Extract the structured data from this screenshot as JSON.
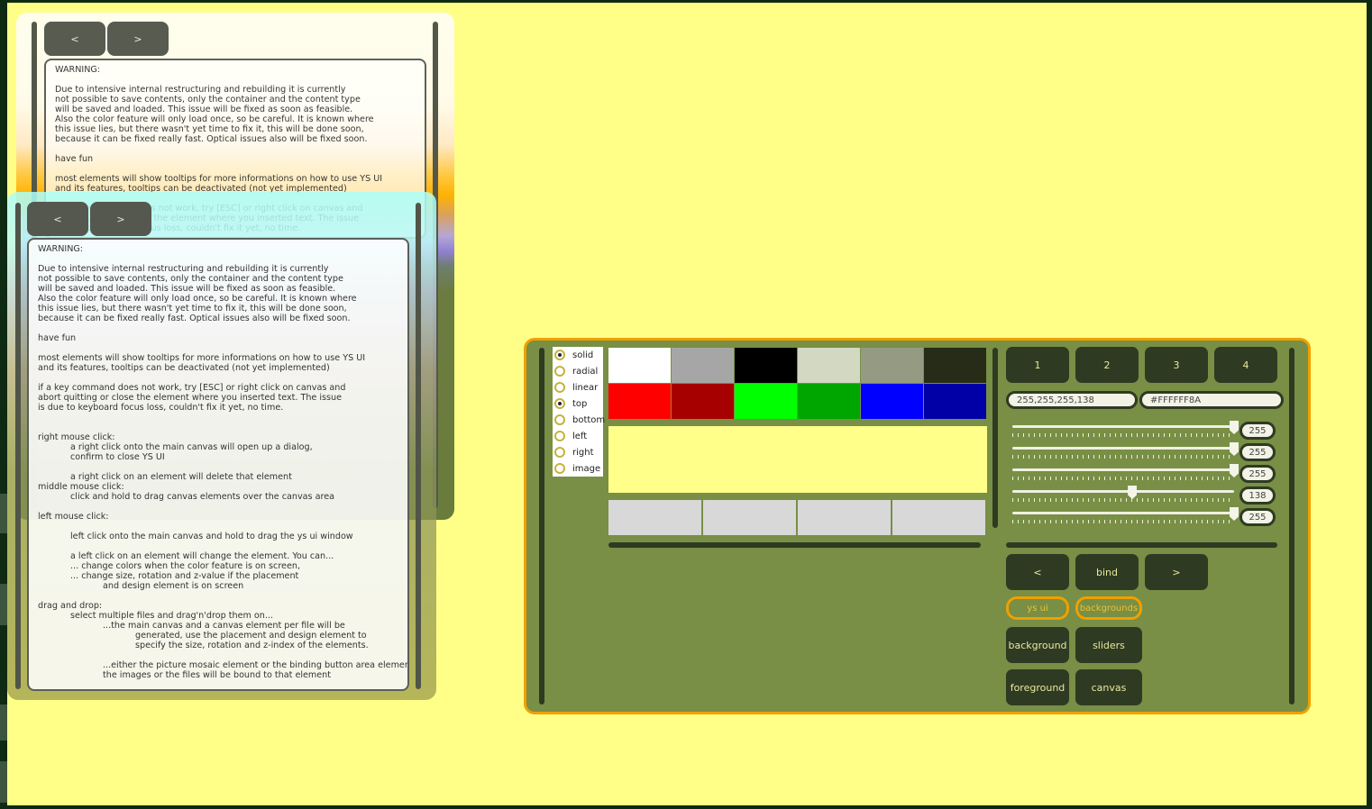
{
  "panel": {
    "prev_label": "<",
    "next_label": ">",
    "warning_title": "WARNING:",
    "intro": [
      "Due to intensive internal restructuring and rebuilding it is currently",
      "not possible to save contents, only the container and the content type",
      "will be saved and loaded. This issue will be fixed as soon as feasible.",
      "Also the color feature will only load once, so be careful. It is known where",
      "this issue lies, but there wasn't yet time to fix it, this will be done soon,",
      "because it can be fixed really fast. Optical issues also will be fixed soon."
    ],
    "have_fun": "have fun",
    "tooltips": [
      "most elements will show tooltips for more informations on how to use YS UI",
      "and its features, tooltips can be deactivated (not yet implemented)"
    ],
    "keycmd": [
      "if a key command does not work, try [ESC] or right click on canvas and",
      "abort quitting or close the element where you inserted text. The issue",
      "is due to keyboard focus loss, couldn't fix it yet, no time."
    ],
    "right_click_title": "right mouse click:",
    "right_click_canvas": [
      "a right click onto the main canvas will open up a dialog,",
      "confirm to close YS UI"
    ],
    "right_click_element": "a right click on an element will delete that element",
    "middle_click_title": "middle mouse click:",
    "middle_click_text": "click and hold to drag canvas elements over the canvas area",
    "left_click_title": "left mouse click:",
    "left_click_canvas": "left click onto the main canvas and hold to drag the ys ui window",
    "left_click_element": [
      "a left click on an element will change the element. You can...",
      "... change colors when the color feature is on screen,",
      "... change size, rotation and z-value if the placement"
    ],
    "left_click_element_cont": "and design element is on screen",
    "dragdrop_title": "drag and drop:",
    "dragdrop_text": "select multiple files and drag'n'drop them on...",
    "dragdrop_main": "...the main canvas and a canvas element per file will be",
    "dragdrop_main_cont": [
      "generated, use the placement and design element to",
      "specify the size, rotation and z-index of the elements."
    ],
    "dragdrop_mosaic": [
      "...either the picture mosaic element or the binding button area element,",
      "the images or the files will be bound to that element"
    ]
  },
  "color_widget": {
    "fill_modes": [
      {
        "label": "solid",
        "selected": true
      },
      {
        "label": "radial",
        "selected": false
      },
      {
        "label": "linear",
        "selected": false
      },
      {
        "label": "top",
        "selected": true
      },
      {
        "label": "bottom",
        "selected": false
      },
      {
        "label": "left",
        "selected": false
      },
      {
        "label": "right",
        "selected": false
      },
      {
        "label": "image",
        "selected": false
      }
    ],
    "swatches": [
      "#ffffff",
      "#a6a6a6",
      "#000000",
      "#d2d8c2",
      "#959b83",
      "#262c17",
      "#ff0000",
      "#a60000",
      "#00ff00",
      "#00a600",
      "#0000ff",
      "#0000a6"
    ],
    "preview_color": "#ffff8a",
    "tabs": [
      "1",
      "2",
      "3",
      "4"
    ],
    "rgba_value": "255,255,255,138",
    "hex_value": "#FFFFFF8A",
    "sliders": [
      {
        "value": 255,
        "max": 255
      },
      {
        "value": 255,
        "max": 255
      },
      {
        "value": 255,
        "max": 255
      },
      {
        "value": 138,
        "max": 255
      },
      {
        "value": 255,
        "max": 255
      }
    ],
    "prev_label": "<",
    "bind_label": "bind",
    "next_label": ">",
    "target_ys_ui": "ys ui",
    "target_backgrounds": "backgrounds",
    "btn_background": "background",
    "btn_sliders": "sliders",
    "btn_foreground": "foreground",
    "btn_canvas": "canvas"
  }
}
